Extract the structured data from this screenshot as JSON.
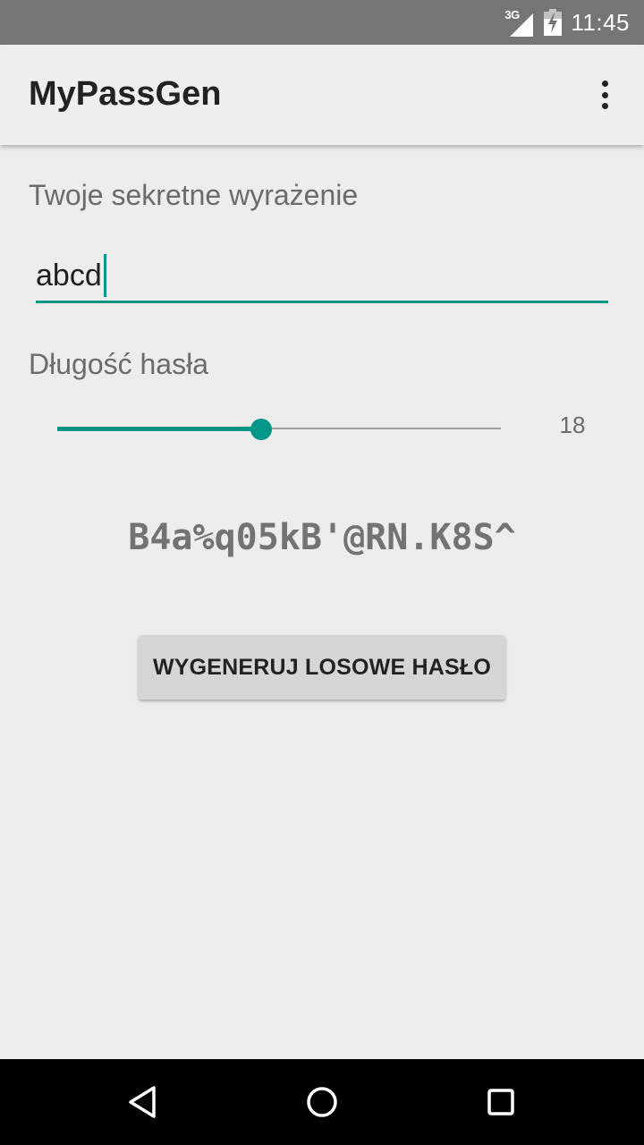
{
  "status_bar": {
    "network": "3G",
    "time": "11:45",
    "icons": [
      "signal-icon",
      "battery-charging-icon"
    ]
  },
  "app_bar": {
    "title": "MyPassGen",
    "menu_icon": "overflow-menu-icon"
  },
  "form": {
    "secret_label": "Twoje sekretne wyrażenie",
    "secret_value": "abcd",
    "length_label": "Długość hasła",
    "length_value": "18",
    "length_fraction": 0.46
  },
  "result": {
    "password": "B4a%q05kB'@RN.K8S^"
  },
  "actions": {
    "generate_label": "WYGENERUJ LOSOWE HASŁO"
  },
  "nav_bar": {
    "icons": [
      "back-icon",
      "home-icon",
      "recents-icon"
    ]
  },
  "colors": {
    "accent": "#009688",
    "status_bar": "#757575",
    "background": "#ededed"
  }
}
